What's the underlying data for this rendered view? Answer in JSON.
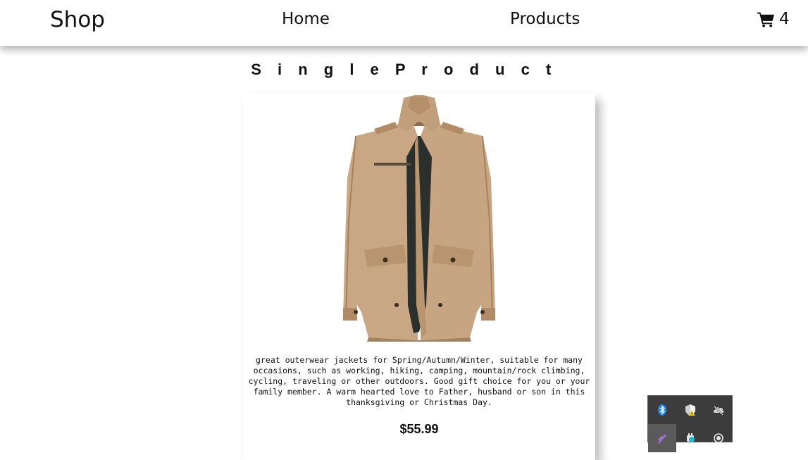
{
  "navbar": {
    "brand": "Shop",
    "links": [
      {
        "label": "Home"
      },
      {
        "label": "Products"
      }
    ],
    "cart_count": "4",
    "cart_icon": "shopping-cart-icon"
  },
  "page": {
    "title": "S i n g l e P r o d u c t"
  },
  "product": {
    "image_icon": "jacket-image",
    "description": "great outerwear jackets for Spring/Autumn/Winter, suitable for many occasions, such as working, hiking, camping, mountain/rock climbing, cycling, traveling or other outdoors. Good gift choice for you or your family member. A warm hearted love to Father, husband or son in this thanksgiving or Christmas Day.",
    "price": "$55.99"
  },
  "tray": {
    "icons": [
      "bluetooth-icon",
      "shield-warning-icon",
      "cloud-offline-icon",
      "pen-icon",
      "meet-icon",
      "record-icon"
    ]
  },
  "colors": {
    "jacket": "#c9a784",
    "jacket_dark": "#a5825f",
    "lining": "#2b302c",
    "tray_bg": "#3c3c3c",
    "bluetooth": "#1e88e5"
  }
}
